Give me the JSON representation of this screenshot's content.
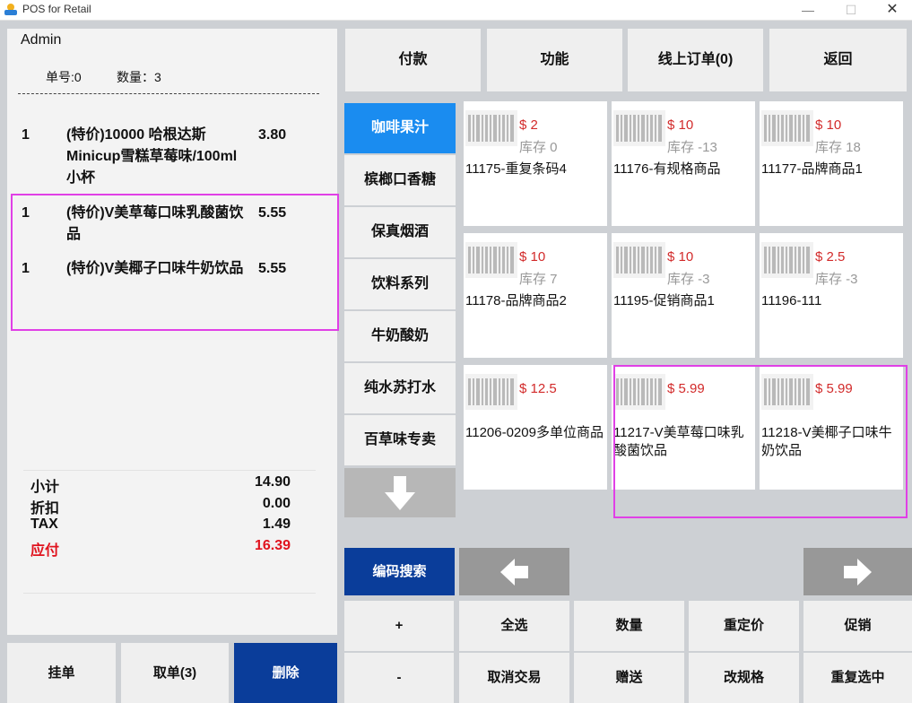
{
  "window": {
    "title": "POS for Retail",
    "minimize": "—",
    "maximize": "☐",
    "close": "✕"
  },
  "receipt": {
    "user": "Admin",
    "order_no": "单号:0",
    "count": "数量：3",
    "items": [
      {
        "qty": "1",
        "name": "(特价)10000 哈根达斯Minicup雪糕草莓味/100ml小杯",
        "price": "3.80"
      },
      {
        "qty": "1",
        "name": "(特价)V美草莓口味乳酸菌饮品",
        "price": "5.55"
      },
      {
        "qty": "1",
        "name": "(特价)V美椰子口味牛奶饮品",
        "price": "5.55"
      }
    ],
    "totals": {
      "subtotal_label": "小计",
      "subtotal": "14.90",
      "discount_label": "折扣",
      "discount": "0.00",
      "tax_label": "TAX",
      "tax": "1.49",
      "due_label": "应付",
      "due": "16.39"
    }
  },
  "bottom_buttons": {
    "hold": "挂单",
    "recall": "取单(3)",
    "delete": "删除"
  },
  "top_tabs": {
    "pay": "付款",
    "function": "功能",
    "online_orders": "线上订单(0)",
    "back": "返回"
  },
  "categories": [
    "咖啡果汁",
    "槟榔口香糖",
    "保真烟酒",
    "饮料系列",
    "牛奶酸奶",
    "纯水苏打水",
    "百草味专卖"
  ],
  "products": [
    {
      "price": "$ 2",
      "stock": "库存 0",
      "name": "11175-重复条码4"
    },
    {
      "price": "$ 10",
      "stock": "库存 -13",
      "name": "11176-有规格商品"
    },
    {
      "price": "$ 10",
      "stock": "库存 18",
      "name": "11177-品牌商品1"
    },
    {
      "price": "$ 10",
      "stock": "库存 7",
      "name": "11178-品牌商品2"
    },
    {
      "price": "$ 10",
      "stock": "库存 -3",
      "name": "11195-促销商品1"
    },
    {
      "price": "$ 2.5",
      "stock": "库存 -3",
      "name": "11196-111"
    },
    {
      "price": "$ 12.5",
      "stock": "",
      "name": "11206-0209多单位商品"
    },
    {
      "price": "$ 5.99",
      "stock": "",
      "name": "11217-V美草莓口味乳酸菌饮品"
    },
    {
      "price": "$ 5.99",
      "stock": "",
      "name": "11218-V美椰子口味牛奶饮品"
    }
  ],
  "search": {
    "code_search": "编码搜索"
  },
  "keypad": {
    "plus": "+",
    "select_all": "全选",
    "quantity": "数量",
    "reprice": "重定价",
    "promotion": "促销",
    "minus": "-",
    "cancel_trade": "取消交易",
    "gift": "赠送",
    "change_spec": "改规格",
    "reselect": "重复选中"
  },
  "colors": {
    "primary": "#0a3d9a",
    "active_category": "#1a8cf0",
    "price": "#d22a2a",
    "due": "#e0131e",
    "selection": "#e040e6"
  }
}
